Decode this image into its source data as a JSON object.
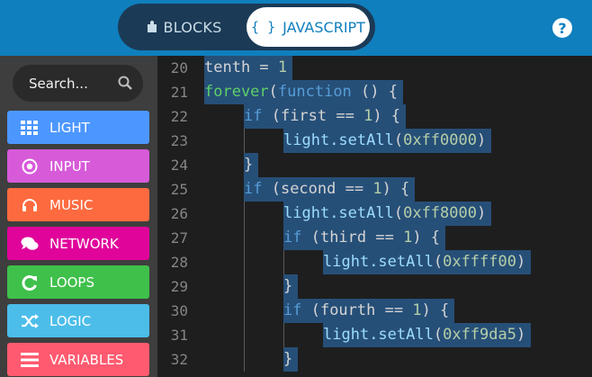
{
  "header": {
    "blocks_label": "BLOCKS",
    "javascript_label": "JAVASCRIPT",
    "javascript_icon_text": "{ }",
    "help_label": "?"
  },
  "toolbox": {
    "search_placeholder": "Search...",
    "categories": [
      {
        "label": "LIGHT",
        "color": "#4c97ff",
        "icon": "grid-icon"
      },
      {
        "label": "INPUT",
        "color": "#d75ad9",
        "icon": "target-icon"
      },
      {
        "label": "MUSIC",
        "color": "#fe6a3f",
        "icon": "headphones-icon"
      },
      {
        "label": "NETWORK",
        "color": "#e0049b",
        "icon": "chat-icon"
      },
      {
        "label": "LOOPS",
        "color": "#3fc04b",
        "icon": "loop-icon"
      },
      {
        "label": "LOGIC",
        "color": "#4cbde9",
        "icon": "shuffle-icon"
      },
      {
        "label": "VARIABLES",
        "color": "#ff5a6f",
        "icon": "list-icon"
      }
    ]
  },
  "editor": {
    "lines": [
      {
        "num": "20",
        "indent": 0,
        "tokens": [
          {
            "t": "tenth = ",
            "c": ""
          },
          {
            "t": "1",
            "c": "num"
          }
        ]
      },
      {
        "num": "21",
        "indent": 0,
        "tokens": [
          {
            "t": "forever",
            "c": "fn"
          },
          {
            "t": "(",
            "c": ""
          },
          {
            "t": "function",
            "c": "kw"
          },
          {
            "t": " () {",
            "c": ""
          }
        ]
      },
      {
        "num": "22",
        "indent": 1,
        "tokens": [
          {
            "t": "if",
            "c": "kw"
          },
          {
            "t": " (first == ",
            "c": ""
          },
          {
            "t": "1",
            "c": "num"
          },
          {
            "t": ") {",
            "c": ""
          }
        ]
      },
      {
        "num": "23",
        "indent": 2,
        "tokens": [
          {
            "t": "light",
            "c": "obj"
          },
          {
            "t": ".setAll",
            "c": "obj"
          },
          {
            "t": "(",
            "c": ""
          },
          {
            "t": "0xff0000",
            "c": "num"
          },
          {
            "t": ")",
            "c": ""
          }
        ]
      },
      {
        "num": "24",
        "indent": 1,
        "tokens": [
          {
            "t": "}",
            "c": ""
          }
        ]
      },
      {
        "num": "25",
        "indent": 1,
        "tokens": [
          {
            "t": "if",
            "c": "kw"
          },
          {
            "t": " (second == ",
            "c": ""
          },
          {
            "t": "1",
            "c": "num"
          },
          {
            "t": ") {",
            "c": ""
          }
        ]
      },
      {
        "num": "26",
        "indent": 2,
        "tokens": [
          {
            "t": "light",
            "c": "obj"
          },
          {
            "t": ".setAll",
            "c": "obj"
          },
          {
            "t": "(",
            "c": ""
          },
          {
            "t": "0xff8000",
            "c": "num"
          },
          {
            "t": ")",
            "c": ""
          }
        ]
      },
      {
        "num": "27",
        "indent": 2,
        "tokens": [
          {
            "t": "if",
            "c": "kw"
          },
          {
            "t": " (third == ",
            "c": ""
          },
          {
            "t": "1",
            "c": "num"
          },
          {
            "t": ") {",
            "c": ""
          }
        ]
      },
      {
        "num": "28",
        "indent": 3,
        "tokens": [
          {
            "t": "light",
            "c": "obj"
          },
          {
            "t": ".setAll",
            "c": "obj"
          },
          {
            "t": "(",
            "c": ""
          },
          {
            "t": "0xffff00",
            "c": "num"
          },
          {
            "t": ")",
            "c": ""
          }
        ]
      },
      {
        "num": "29",
        "indent": 2,
        "tokens": [
          {
            "t": "}",
            "c": ""
          }
        ]
      },
      {
        "num": "30",
        "indent": 2,
        "tokens": [
          {
            "t": "if",
            "c": "kw"
          },
          {
            "t": " (fourth == ",
            "c": ""
          },
          {
            "t": "1",
            "c": "num"
          },
          {
            "t": ") {",
            "c": ""
          }
        ]
      },
      {
        "num": "31",
        "indent": 3,
        "tokens": [
          {
            "t": "light",
            "c": "obj"
          },
          {
            "t": ".setAll",
            "c": "obj"
          },
          {
            "t": "(",
            "c": ""
          },
          {
            "t": "0xff9da5",
            "c": "num"
          },
          {
            "t": ")",
            "c": ""
          }
        ]
      },
      {
        "num": "32",
        "indent": 2,
        "tokens": [
          {
            "t": "}",
            "c": ""
          }
        ]
      }
    ]
  }
}
